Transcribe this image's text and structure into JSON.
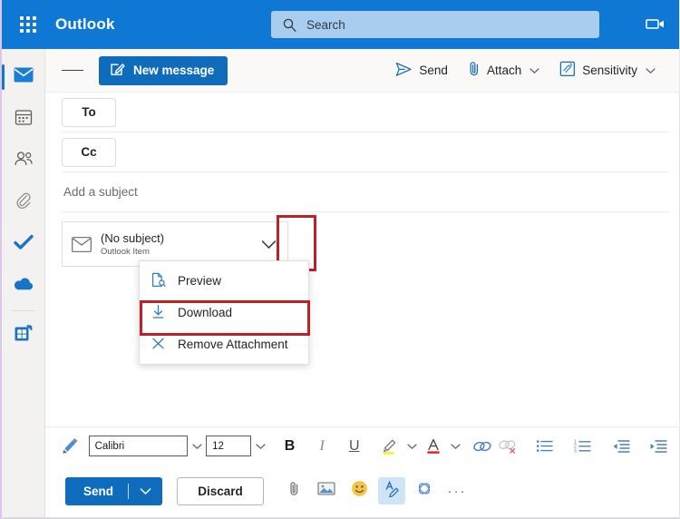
{
  "header": {
    "app_name": "Outlook",
    "waffle_icon": "app-launcher-icon",
    "search_placeholder": "Search",
    "search_icon": "search-icon",
    "meet_icon": "video-camera-icon",
    "bg_color": "#0f78d4",
    "search_bg": "#a9cdee"
  },
  "rail": {
    "items": [
      {
        "name": "mail",
        "icon": "envelope-icon",
        "active": true
      },
      {
        "name": "calendar",
        "icon": "calendar-icon",
        "active": false
      },
      {
        "name": "people",
        "icon": "people-icon",
        "active": false
      },
      {
        "name": "files",
        "icon": "paperclip-icon",
        "active": false
      },
      {
        "name": "to-do",
        "icon": "checkmark-icon",
        "active": false
      },
      {
        "name": "onedrive",
        "icon": "cloud-icon",
        "active": false
      },
      {
        "name": "apps",
        "icon": "apps-grid-icon",
        "active": false
      }
    ]
  },
  "toolbar": {
    "hamburger_icon": "hamburger-menu-icon",
    "new_message_label": "New message",
    "new_message_icon": "compose-icon",
    "send_label": "Send",
    "send_icon": "send-plane-icon",
    "attach_label": "Attach",
    "attach_icon": "paperclip-icon",
    "sensitivity_label": "Sensitivity",
    "sensitivity_icon": "sensitivity-tag-icon",
    "chevron_icon": "chevron-down-icon"
  },
  "compose": {
    "to_label": "To",
    "cc_label": "Cc",
    "subject_placeholder": "Add a subject",
    "attachment": {
      "icon": "envelope-icon",
      "title": "(No subject)",
      "subtitle": "Outlook Item",
      "chevron_icon": "chevron-down-icon",
      "highlight_color": "#bf2026"
    },
    "menu": {
      "items": [
        {
          "label": "Preview",
          "icon": "preview-document-icon",
          "highlighted": false
        },
        {
          "label": "Download",
          "icon": "download-arrow-icon",
          "highlighted": true
        },
        {
          "label": "Remove Attachment",
          "icon": "close-x-icon",
          "highlighted": false
        }
      ]
    }
  },
  "format_bar": {
    "format_painter_icon": "format-painter-icon",
    "font_family": "Calibri",
    "font_size": "12",
    "bold_label": "B",
    "italic_label": "I",
    "underline_label": "U",
    "highlight_icon": "text-highlight-icon",
    "font_color_icon": "font-color-icon",
    "link_icon": "insert-link-icon",
    "unlink_icon": "remove-link-icon",
    "bullet_list_icon": "bulleted-list-icon",
    "numbered_list_icon": "numbered-list-icon",
    "decrease_indent_icon": "decrease-indent-icon",
    "increase_indent_icon": "increase-indent-icon",
    "chevron_icon": "chevron-down-icon",
    "highlight_color": "#ffee00",
    "font_color": "#e02020"
  },
  "bottom_bar": {
    "send_label": "Send",
    "send_chevron_icon": "chevron-down-icon",
    "discard_label": "Discard",
    "attach_icon": "paperclip-icon",
    "image_icon": "insert-picture-icon",
    "emoji_icon": "emoji-smiley-icon",
    "formatting_icon": "formatting-options-icon",
    "loop_icon": "loop-component-icon",
    "more_label": "···",
    "more_icon": "more-options-icon"
  }
}
